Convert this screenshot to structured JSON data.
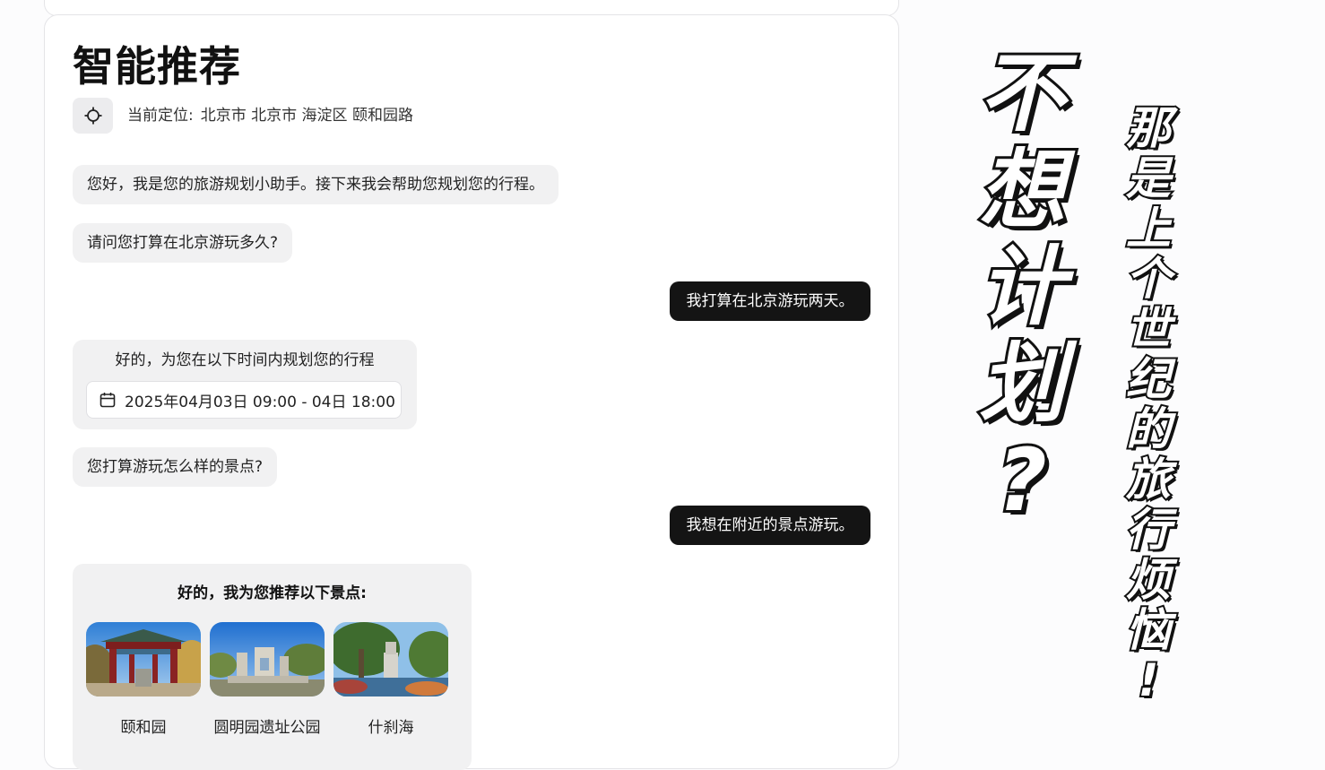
{
  "page": {
    "title": "智能推荐",
    "location": {
      "label": "当前定位:",
      "address": "北京市 北京市 海淀区 颐和园路",
      "icon": "locate-icon"
    }
  },
  "messages": [
    {
      "role": "bot",
      "text": "您好，我是您的旅游规划小助手。接下来我会帮助您规划您的行程。"
    },
    {
      "role": "bot",
      "text": "请问您打算在北京游玩多久?"
    },
    {
      "role": "user",
      "text": "我打算在北京游玩两天。"
    },
    {
      "role": "bot",
      "text": "好的，为您在以下时间内规划您的行程",
      "time_range": "2025年04月03日 09:00 - 04日 18:00"
    },
    {
      "role": "bot",
      "text": "您打算游玩怎么样的景点?"
    },
    {
      "role": "user",
      "text": "我想在附近的景点游玩。"
    },
    {
      "role": "bot",
      "text": "好的，我为您推荐以下景点:"
    }
  ],
  "spots": [
    {
      "name": "颐和园"
    },
    {
      "name": "圆明园遗址公园"
    },
    {
      "name": "什刹海"
    }
  ],
  "overlay": {
    "big": [
      "不",
      "想",
      "计",
      "划",
      "?"
    ],
    "small": [
      "那",
      "是",
      "上",
      "个",
      "世",
      "纪",
      "的",
      "旅",
      "行",
      "烦",
      "恼",
      "!"
    ]
  },
  "colors": {
    "user_bubble": "#141414",
    "bot_bubble": "#f1f1f2",
    "overlay_stroke": "#111111"
  }
}
